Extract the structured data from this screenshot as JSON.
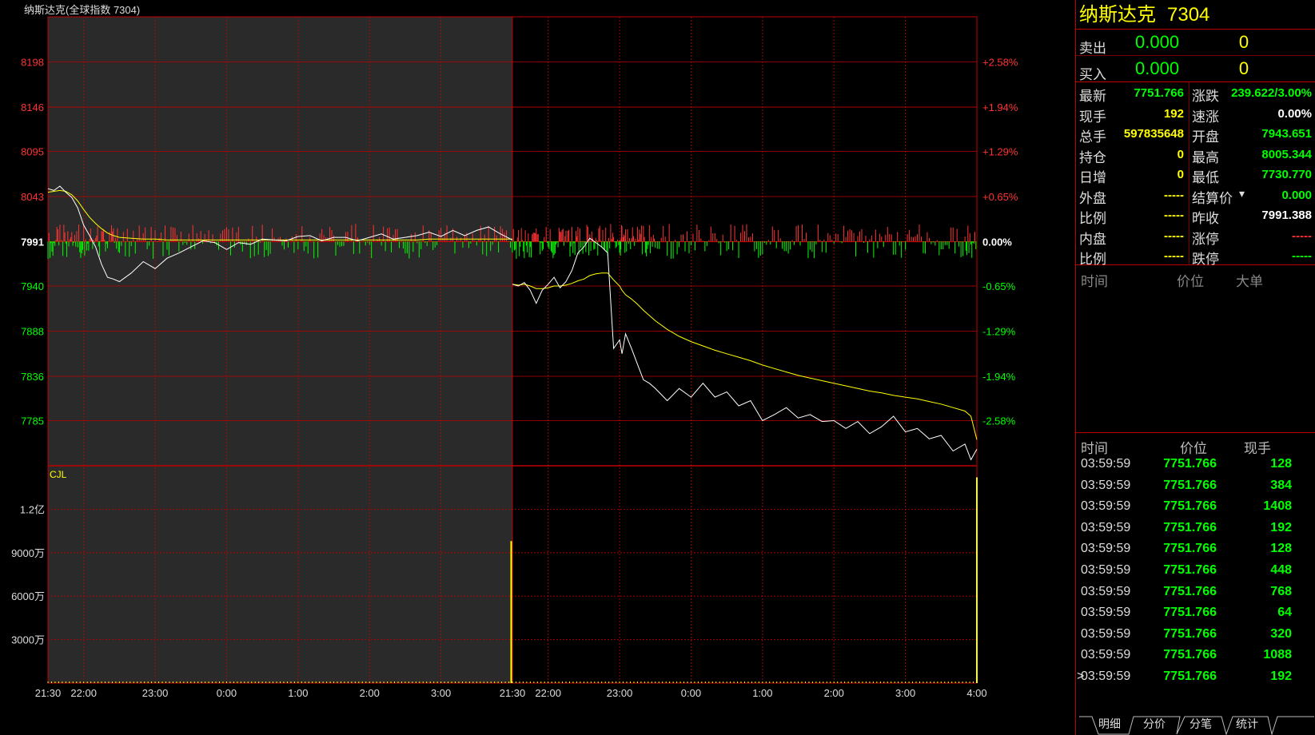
{
  "chart_title": "纳斯达克(全球指数  7304)",
  "volume_label": "CJL",
  "price_axis": {
    "left_labels": [
      "8198",
      "8146",
      "8095",
      "8043",
      "7991",
      "7940",
      "7888",
      "7836",
      "7785"
    ],
    "right_labels": [
      "+2.58%",
      "+1.94%",
      "+1.29%",
      "+0.65%",
      "0.00%",
      "-0.65%",
      "-1.29%",
      "-1.94%",
      "-2.58%"
    ]
  },
  "volume_axis": {
    "labels": [
      "1.2亿",
      "9000万",
      "6000万",
      "3000万"
    ]
  },
  "time_axis": [
    "21:30",
    "22:00",
    "23:00",
    "0:00",
    "1:00",
    "2:00",
    "3:00",
    "21:30",
    "22:00",
    "23:00",
    "0:00",
    "1:00",
    "2:00",
    "3:00",
    "4:00"
  ],
  "colors": {
    "up": "#ff3333",
    "down": "#00ff00",
    "price_line": "#ffffff",
    "avg_line": "#ffff00",
    "grid": "#c00000",
    "history_bg": "#2a2a2a"
  },
  "chart_data": {
    "type": "line",
    "prev_close": 7991.388,
    "ylim": [
      7733,
      8250
    ],
    "volume_ylim": [
      0,
      150000000
    ],
    "series": [
      {
        "days": "previous",
        "x": [
          0,
          5,
          10,
          15,
          20,
          25,
          30,
          35,
          40,
          45,
          50,
          55,
          60,
          70,
          80,
          90,
          100,
          110,
          120,
          130,
          140,
          150,
          160,
          170,
          180,
          190,
          200,
          210,
          220,
          230,
          240,
          250,
          260,
          270,
          280,
          290,
          300,
          310,
          320,
          330,
          340,
          350,
          360,
          370,
          380,
          390
        ],
        "price": [
          8052,
          8050,
          8055,
          8048,
          8042,
          8030,
          8010,
          7998,
          7985,
          7965,
          7950,
          7948,
          7945,
          7955,
          7968,
          7960,
          7972,
          7978,
          7985,
          7992,
          7990,
          7982,
          7990,
          7988,
          7994,
          7993,
          7992,
          7997,
          7998,
          7992,
          7996,
          7996,
          7992,
          7996,
          8000,
          7994,
          7996,
          7998,
          8002,
          7997,
          8004,
          7998,
          8004,
          8008,
          8000,
          7993
        ],
        "avg": [
          8048,
          8049,
          8050,
          8049,
          8045,
          8038,
          8028,
          8019,
          8012,
          8006,
          8001,
          7998,
          7996,
          7995,
          7994,
          7994,
          7993,
          7993,
          7993,
          7993,
          7993,
          7993,
          7993,
          7993,
          7993,
          7993,
          7993,
          7993,
          7993,
          7993,
          7993,
          7993,
          7993,
          7993,
          7993,
          7993,
          7993,
          7993,
          7994,
          7994,
          7994,
          7994,
          7994,
          7994,
          7994,
          7994
        ]
      },
      {
        "days": "current",
        "x": [
          0,
          5,
          10,
          15,
          20,
          25,
          30,
          35,
          40,
          45,
          50,
          55,
          60,
          65,
          70,
          75,
          80,
          85,
          90,
          92,
          95,
          100,
          105,
          110,
          115,
          120,
          130,
          140,
          150,
          160,
          170,
          180,
          190,
          200,
          210,
          220,
          230,
          240,
          250,
          260,
          270,
          280,
          290,
          300,
          310,
          320,
          330,
          340,
          350,
          360,
          370,
          380,
          385,
          390
        ],
        "price": [
          7942,
          7940,
          7944,
          7935,
          7920,
          7935,
          7942,
          7950,
          7938,
          7945,
          7958,
          7978,
          7985,
          7995,
          7990,
          7985,
          7978,
          7868,
          7878,
          7862,
          7885,
          7868,
          7850,
          7832,
          7828,
          7822,
          7808,
          7822,
          7812,
          7828,
          7812,
          7818,
          7802,
          7808,
          7785,
          7792,
          7800,
          7788,
          7792,
          7784,
          7785,
          7776,
          7784,
          7770,
          7778,
          7790,
          7772,
          7776,
          7764,
          7768,
          7750,
          7758,
          7740,
          7752
        ],
        "avg": [
          7942,
          7941,
          7942,
          7940,
          7937,
          7937,
          7938,
          7940,
          7940,
          7941,
          7943,
          7946,
          7948,
          7952,
          7954,
          7955,
          7955,
          7947,
          7940,
          7935,
          7930,
          7925,
          7919,
          7912,
          7906,
          7900,
          7890,
          7882,
          7876,
          7871,
          7866,
          7862,
          7858,
          7854,
          7849,
          7845,
          7841,
          7837,
          7834,
          7831,
          7828,
          7825,
          7822,
          7819,
          7817,
          7814,
          7812,
          7810,
          7807,
          7804,
          7800,
          7796,
          7790,
          7763
        ]
      }
    ],
    "volume_spikes": [
      {
        "day": "previous",
        "x": 389,
        "value": 98000000
      },
      {
        "day": "current",
        "x": 390,
        "value": 142000000
      }
    ]
  },
  "panel": {
    "title_name": "纳斯达克",
    "title_code": "7304",
    "ask": {
      "label": "卖出",
      "price": "0.000",
      "vol": "0"
    },
    "bid": {
      "label": "买入",
      "price": "0.000",
      "vol": "0"
    },
    "quote": [
      {
        "l1": "最新",
        "v1": "7751.766",
        "c1": "#00ff00",
        "l2": "涨跌",
        "v2": "239.622/3.00%",
        "c2": "#00ff00"
      },
      {
        "l1": "现手",
        "v1": "192",
        "c1": "#ffff00",
        "l2": "速涨",
        "v2": "0.00%",
        "c2": "#ffffff"
      },
      {
        "l1": "总手",
        "v1": "597835648",
        "c1": "#ffff00",
        "l2": "开盘",
        "v2": "7943.651",
        "c2": "#00ff00"
      },
      {
        "l1": "持仓",
        "v1": "0",
        "c1": "#ffff00",
        "l2": "最高",
        "v2": "8005.344",
        "c2": "#00ff00"
      },
      {
        "l1": "日增",
        "v1": "0",
        "c1": "#ffff00",
        "l2": "最低",
        "v2": "7730.770",
        "c2": "#00ff00"
      },
      {
        "l1": "外盘",
        "v1": "-----",
        "c1": "#ffff00",
        "l2": "结算价",
        "v2": "0.000",
        "c2": "#00ff00"
      },
      {
        "l1": "比例",
        "v1": "-----",
        "c1": "#ffff00",
        "l2": "昨收",
        "v2": "7991.388",
        "c2": "#ffffff"
      },
      {
        "l1": "内盘",
        "v1": "-----",
        "c1": "#ffff00",
        "l2": "涨停",
        "v2": "-----",
        "c2": "#ff3333"
      },
      {
        "l1": "比例",
        "v1": "-----",
        "c1": "#ffff00",
        "l2": "跌停",
        "v2": "-----",
        "c2": "#00ff00"
      }
    ],
    "big_order_headers": {
      "time": "时间",
      "price": "价位",
      "big": "大单"
    },
    "tick_headers": {
      "time": "时间",
      "price": "价位",
      "vol": "现手"
    },
    "ticks": [
      {
        "t": "03:59:59",
        "p": "7751.766",
        "v": "128"
      },
      {
        "t": "03:59:59",
        "p": "7751.766",
        "v": "384"
      },
      {
        "t": "03:59:59",
        "p": "7751.766",
        "v": "1408"
      },
      {
        "t": "03:59:59",
        "p": "7751.766",
        "v": "192"
      },
      {
        "t": "03:59:59",
        "p": "7751.766",
        "v": "128"
      },
      {
        "t": "03:59:59",
        "p": "7751.766",
        "v": "448"
      },
      {
        "t": "03:59:59",
        "p": "7751.766",
        "v": "768"
      },
      {
        "t": "03:59:59",
        "p": "7751.766",
        "v": "64"
      },
      {
        "t": "03:59:59",
        "p": "7751.766",
        "v": "320"
      },
      {
        "t": "03:59:59",
        "p": "7751.766",
        "v": "1088"
      },
      {
        "t": "03:59:59",
        "p": "7751.766",
        "v": "192"
      }
    ],
    "current_marker": ">",
    "tabs": [
      "明细",
      "分价",
      "分笔",
      "统计"
    ]
  }
}
